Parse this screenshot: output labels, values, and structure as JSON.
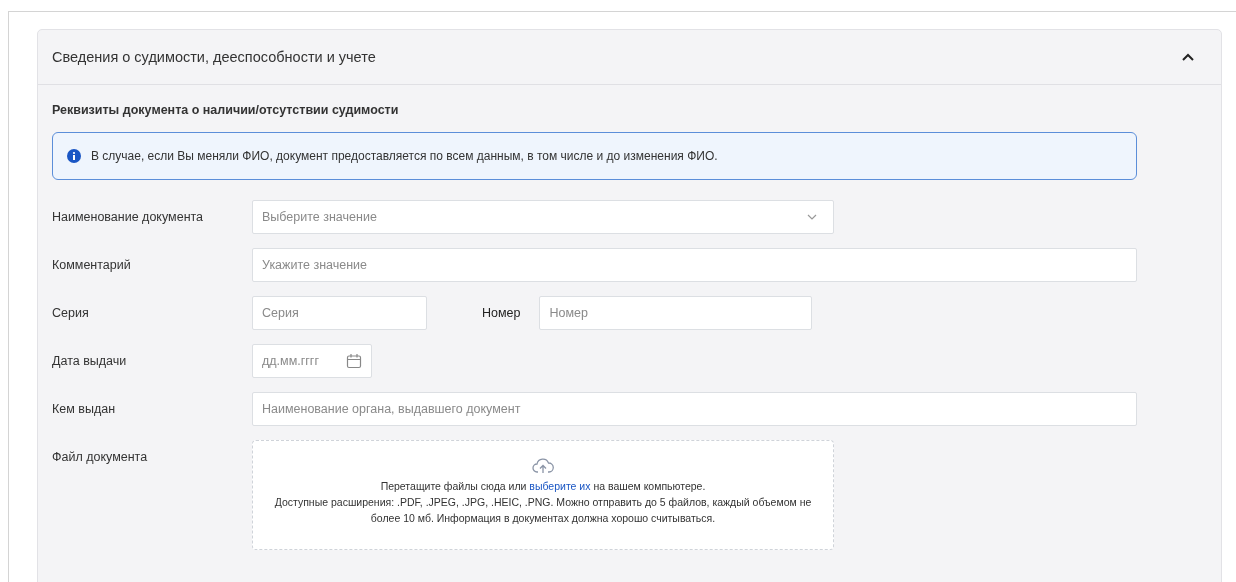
{
  "section": {
    "title": "Сведения о судимости, дееспособности и учете",
    "expanded": true
  },
  "subtitle": "Реквизиты документа о наличии/отсутствии судимости",
  "info": "В случае, если Вы меняли ФИО, документ предоставляется по всем данным, в том числе и до изменения ФИО.",
  "rows": [
    {
      "kind": "select",
      "label": "Наименование документа",
      "placeholder": "Выберите значение"
    },
    {
      "kind": "text",
      "label": "Комментарий",
      "placeholder": "Укажите значение"
    },
    {
      "kind": "pair",
      "label": "Серия",
      "placeholder": "Серия",
      "label_2": "Номер",
      "placeholder_2": "Номер"
    },
    {
      "kind": "date",
      "label": "Дата выдачи",
      "placeholder": "дд.мм.гггг"
    },
    {
      "kind": "text",
      "label": "Кем выдан",
      "placeholder": "Наименование органа, выдавшего документ"
    },
    {
      "kind": "upload",
      "label": "Файл документа",
      "before": "Перетащите файлы сюда или",
      "link": "выберите их",
      "after": "на вашем компьютере.",
      "hint": "Доступные расширения: .PDF, .JPEG, .JPG, .HEIC, .PNG. Можно отправить до 5 файлов, каждый объемом не более 10 мб. Информация в документах должна хорошо считываться."
    }
  ]
}
